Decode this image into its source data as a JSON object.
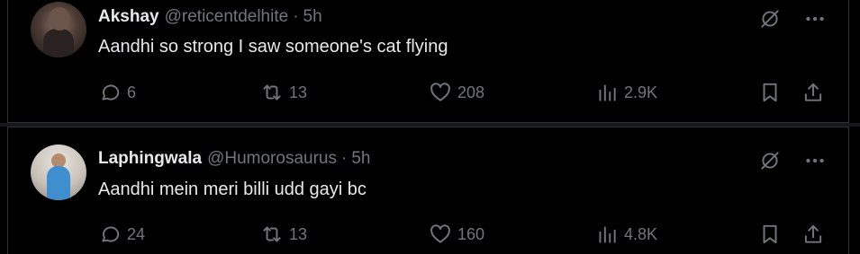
{
  "tweets": [
    {
      "name": "Akshay",
      "handle": "@reticentdelhite",
      "separator": "·",
      "time": "5h",
      "text": "Aandhi so strong I saw someone's cat flying",
      "replies": "6",
      "retweets": "13",
      "likes": "208",
      "views": "2.9K"
    },
    {
      "name": "Laphingwala",
      "handle": "@Humorosaurus",
      "separator": "·",
      "time": "5h",
      "text": "Aandhi mein meri billi udd gayi bc",
      "replies": "24",
      "retweets": "13",
      "likes": "160",
      "views": "4.8K"
    }
  ],
  "icons": {
    "grok": "grok-icon",
    "more": "more-icon",
    "reply": "reply-icon",
    "retweet": "retweet-icon",
    "like": "heart-icon",
    "views": "views-icon",
    "bookmark": "bookmark-icon",
    "share": "share-icon"
  },
  "colors": {
    "background": "#000000",
    "text": "#e7e9ea",
    "muted": "#71767b",
    "border": "#2f3336"
  }
}
